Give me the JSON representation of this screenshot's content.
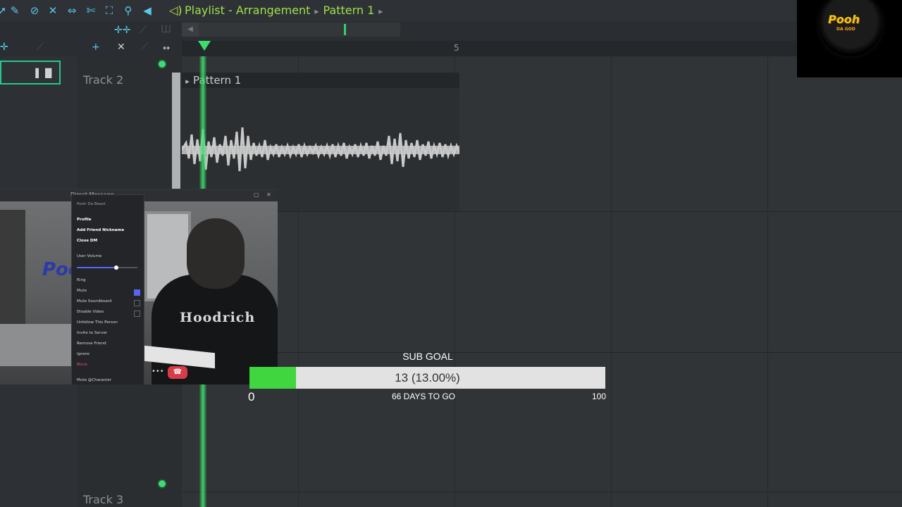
{
  "toolbar": {
    "icons": [
      "pointer-icon",
      "paint-icon",
      "delete-icon",
      "mute-icon",
      "slip-icon",
      "slice-icon",
      "select-icon",
      "zoom-icon",
      "playback-icon"
    ],
    "breadcrumb": {
      "app_window": "Playlist - Arrangement",
      "pattern": "Pattern 1"
    }
  },
  "ruler": {
    "bar_number": "5"
  },
  "tracks": [
    {
      "label": "Track 2"
    },
    {
      "label": "Track 3"
    }
  ],
  "clip": {
    "name": "Pattern 1"
  },
  "webcam": {
    "window_title": "Direct Message",
    "logo_text": "Pooh",
    "hoodie_text": "Hoodrich",
    "context_menu": {
      "header": "Pooh Da Beast",
      "items": [
        "Profile",
        "Add Friend Nickname",
        "Close DM",
        "User Volume",
        "Ring",
        "Mute",
        "Mute Soundboard",
        "Disable Video",
        "Unfollow This Person",
        "Invite to Server",
        "Remove Friend",
        "Ignore",
        "Block",
        "Mute @Character"
      ]
    },
    "checked_item": "Mute"
  },
  "sub_goal": {
    "title": "SUB GOAL",
    "current": 13,
    "progress_text": "13 (13.00%)",
    "percent": 13.0,
    "min_label": "0",
    "max_label": "100",
    "days_text": "66 DAYS TO GO",
    "fill_color": "#3fd63f",
    "track_color": "#e2e2e2"
  },
  "brand": {
    "name": "Pooh",
    "sub": "DA GOD"
  },
  "colors": {
    "accent_green": "#3ade6a",
    "breadcrumb": "#9fe04a",
    "tool_icons": "#59c8ea"
  }
}
